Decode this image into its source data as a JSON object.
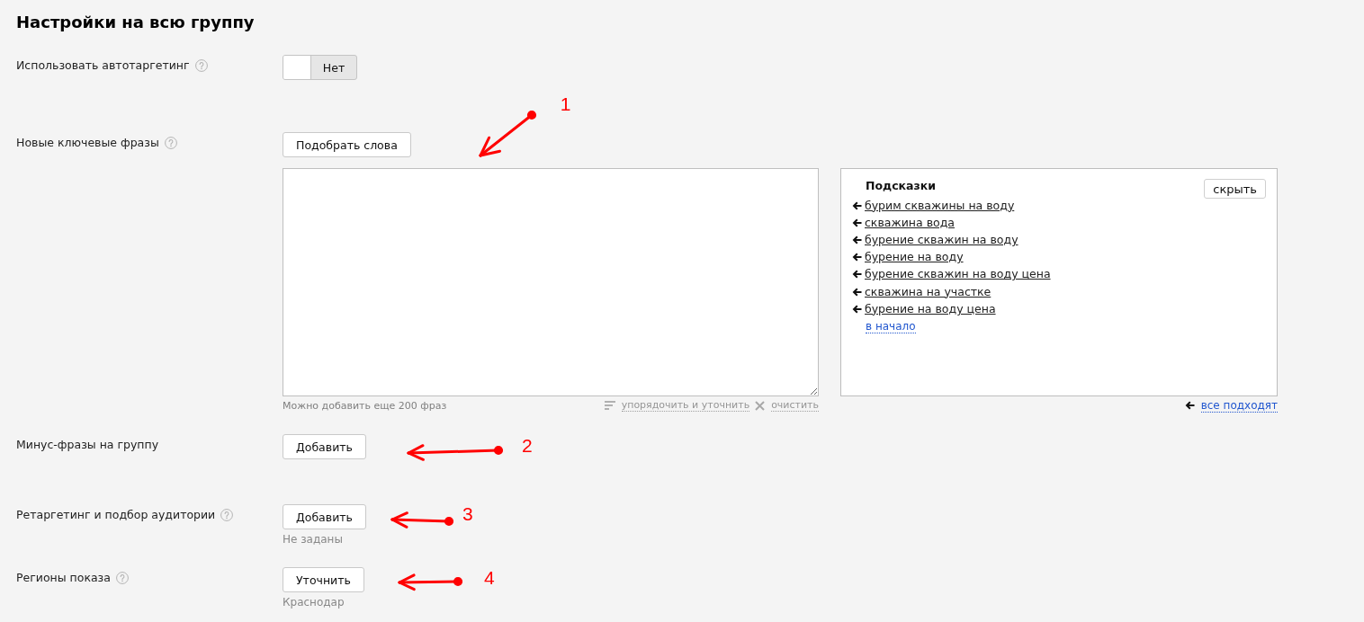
{
  "title": "Настройки на всю группу",
  "rows": [
    {
      "kind": "toggle",
      "label": "Использовать автотаргетинг",
      "help": true,
      "toggle": {
        "on": false,
        "label": "Нет"
      }
    },
    {
      "kind": "keywords",
      "label": "Новые ключевые фразы",
      "help": true,
      "button": "Подобрать слова",
      "annotation": {
        "number": "1"
      },
      "editor": {
        "limit_note": "Можно добавить еще 200 фраз",
        "actions": [
          {
            "kind": "sort",
            "label": "упорядочить и уточнить",
            "disabled": true
          },
          {
            "kind": "clear",
            "label": "очистить",
            "disabled": true
          }
        ]
      },
      "hints": {
        "title": "Подсказки",
        "hide_button": "скрыть",
        "items": [
          "бурим скважины на воду",
          "скважина вода",
          "бурение скважин на воду",
          "бурение на воду",
          "бурение скважин на воду цена",
          "скважина на участке",
          "бурение на воду цена"
        ],
        "to_start": "в начало",
        "accept_all": "все подходят"
      }
    },
    {
      "kind": "button",
      "label": "Минус-фразы на группу",
      "help": false,
      "button": "Добавить",
      "annotation": {
        "number": "2"
      }
    },
    {
      "kind": "button",
      "label": "Ретаргетинг и подбор аудитории",
      "help": true,
      "button": "Добавить",
      "note": "Не заданы",
      "annotation": {
        "number": "3"
      }
    },
    {
      "kind": "button",
      "label": "Регионы показа",
      "help": true,
      "button": "Уточнить",
      "note": "Краснодар",
      "annotation": {
        "number": "4"
      }
    }
  ]
}
